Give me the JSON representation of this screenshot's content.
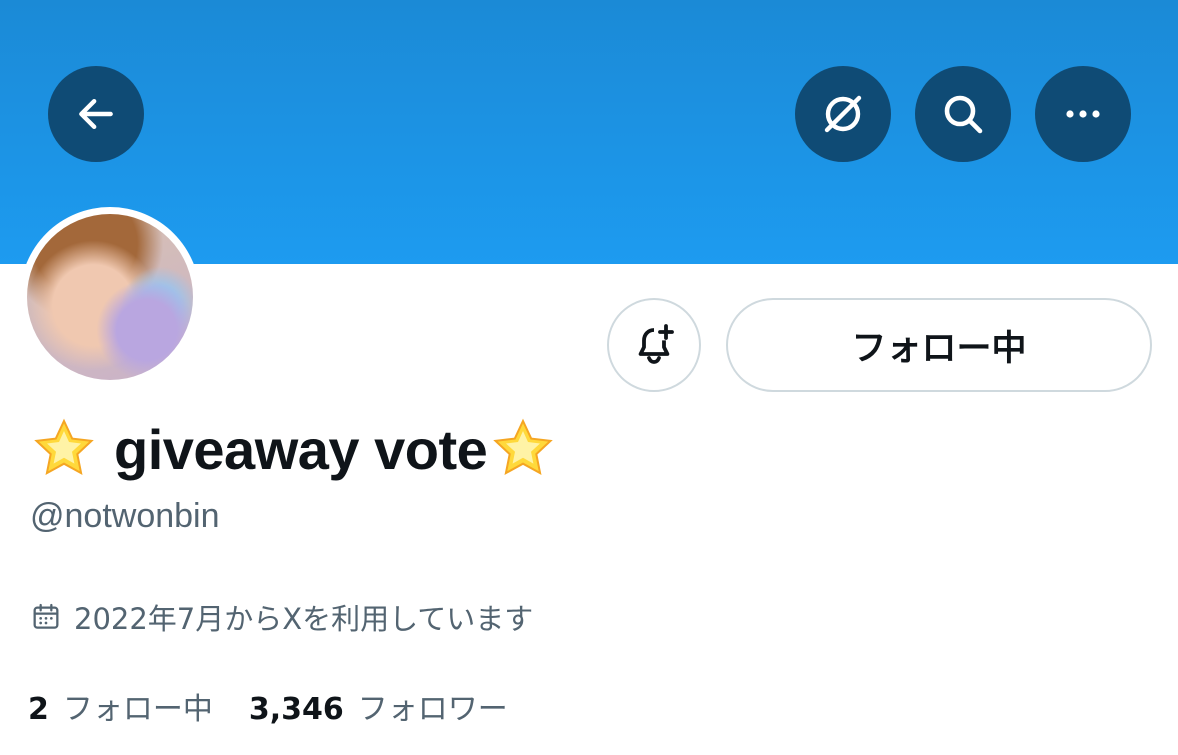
{
  "header": {
    "buttons": [
      {
        "name": "back",
        "icon": "arrow-left-icon"
      },
      {
        "name": "grok-ban",
        "icon": "slash-circle-icon"
      },
      {
        "name": "search",
        "icon": "search-icon"
      },
      {
        "name": "more",
        "icon": "more-horizontal-icon"
      }
    ],
    "banner_color": "#1d9bf0",
    "button_color": "#0f4b75"
  },
  "profile": {
    "name_prefix_emoji": "🌟",
    "display_name": "giveaway vote",
    "name_suffix_emoji": "🌟",
    "handle": "@notwonbin",
    "joined": "2022年7月からXを利用しています",
    "follow_button": "フォロー中",
    "notify_icon": "bell-plus-icon"
  },
  "stats": {
    "following_count": "2",
    "following_label": "フォロー中",
    "followers_count": "3,346",
    "followers_label": "フォロワー"
  }
}
